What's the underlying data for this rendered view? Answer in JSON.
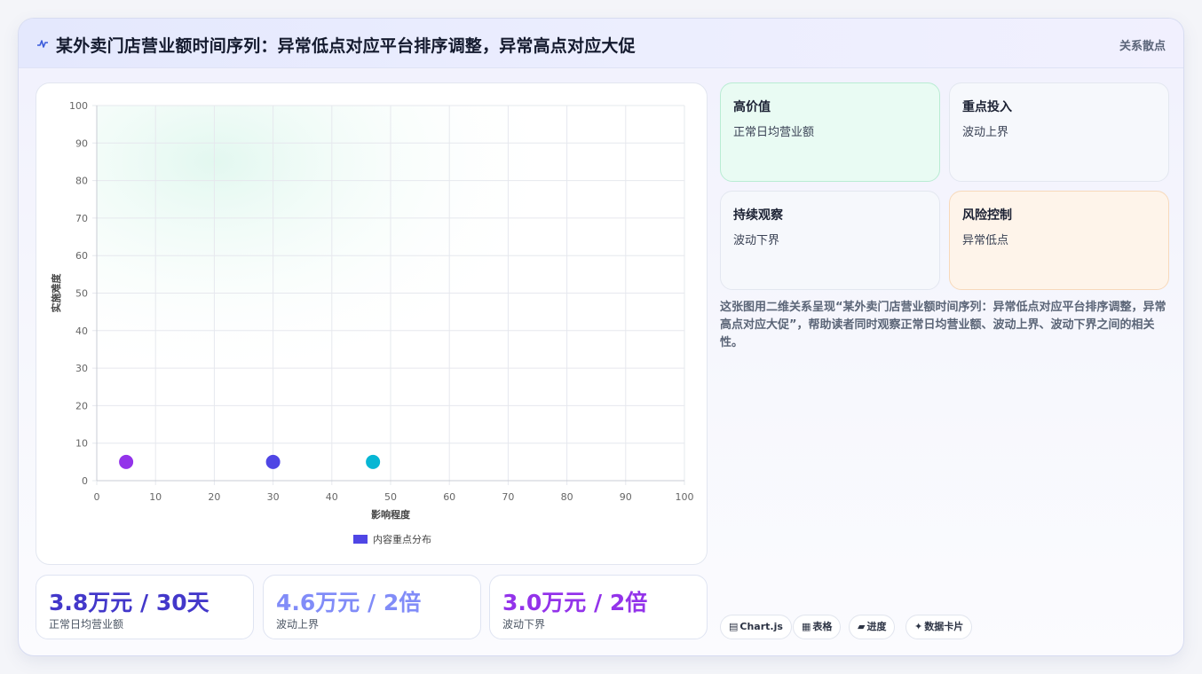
{
  "header": {
    "icon": "pulse-icon",
    "title": "某外卖门店营业额时间序列：异常低点对应平台排序调整，异常高点对应大促",
    "tag": "关系散点"
  },
  "chart_data": {
    "type": "scatter",
    "xlabel": "影响程度",
    "ylabel": "实施难度",
    "xlim": [
      0,
      100
    ],
    "ylim": [
      0,
      100
    ],
    "xticks": [
      0,
      10,
      20,
      30,
      40,
      50,
      60,
      70,
      80,
      90,
      100
    ],
    "yticks": [
      0,
      10,
      20,
      30,
      40,
      50,
      60,
      70,
      80,
      90,
      100
    ],
    "grid": true,
    "legend_position": "bottom",
    "series": [
      {
        "name": "内容重点分布",
        "color": "#4f46e5",
        "points": [
          {
            "x": 5,
            "y": 5,
            "color": "#9333ea"
          },
          {
            "x": 30,
            "y": 5,
            "color": "#4f46e5"
          },
          {
            "x": 47,
            "y": 5,
            "color": "#06b6d4"
          }
        ]
      }
    ]
  },
  "stats": [
    {
      "value": "3.8万元 / 30天",
      "label": "正常日均营业额",
      "color": "#4338ca"
    },
    {
      "value": "4.6万元 / 2倍",
      "label": "波动上界",
      "color": "#818cf8"
    },
    {
      "value": "3.0万元 / 2倍",
      "label": "波动下界",
      "color": "#9333ea"
    }
  ],
  "quadrants": [
    {
      "title": "高价值",
      "sub": "正常日均营业额",
      "bg": "#e9fbf3",
      "border": "#b9ecd3"
    },
    {
      "title": "重点投入",
      "sub": "波动上界",
      "bg": "#f6f8fc",
      "border": "#e3e7f0"
    },
    {
      "title": "持续观察",
      "sub": "波动下界",
      "bg": "#f6f8fc",
      "border": "#e3e7f0"
    },
    {
      "title": "风险控制",
      "sub": "异常低点",
      "bg": "#fef4ea",
      "border": "#f7d9bb"
    }
  ],
  "description": "这张图用二维关系呈现“某外卖门店营业额时间序列：异常低点对应平台排序调整，异常高点对应大促”，帮助读者同时观察正常日均营业额、波动上界、波动下界之间的相关性。",
  "chips": [
    {
      "icon": "▤",
      "label": "Chart.js"
    },
    {
      "icon": "▦",
      "label": "表格"
    },
    {
      "icon": "▰",
      "label": "进度"
    },
    {
      "icon": "✦",
      "label": "数据卡片"
    }
  ]
}
